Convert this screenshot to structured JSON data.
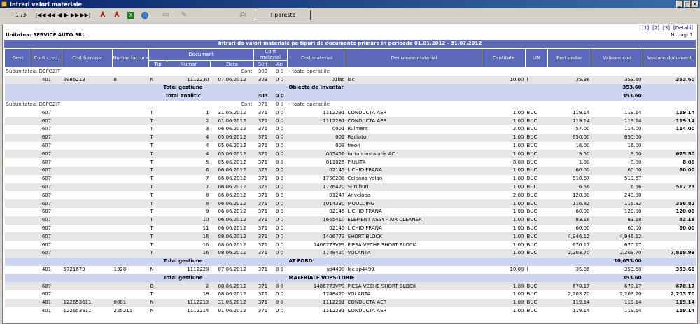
{
  "window": {
    "title": "Intrari valori materiale"
  },
  "toolbar": {
    "page": "1 /3",
    "print_label": "Tipareste",
    "nav": [
      "|◀◀",
      "◀◀",
      "◀",
      "▶",
      "▶▶",
      "▶▶|"
    ]
  },
  "report": {
    "links": [
      "[1]",
      "[2]",
      "[3]",
      "[Detalii]"
    ],
    "unit": "Unitatea: SERVICE AUTO SRL",
    "page_no": "Nr.pag: 1",
    "title": "Intrari de valori materiale pe tipuri de documente primare in perioada 01.01.2012 - 31.07.2012",
    "headers": {
      "gest": "Gest",
      "cont_cred": "Cont cred.",
      "cod_furnizor": "Cod furnizor",
      "numar_factura": "Numar factura",
      "document": "Document",
      "tip": "Tip",
      "numar": "Numar",
      "data": "Data",
      "cont_material": "Cont material",
      "sint": "Sint",
      "an": "An",
      "cod_material": "Cod material",
      "denumire": "Denumire material",
      "cantitate": "Cantitate",
      "um": "UM",
      "pret": "Pret unitar",
      "valoare_cod": "Valoare cod",
      "valoare_doc": "Valoare document"
    },
    "rows": [
      {
        "t": "sub",
        "a": "Subunitatea: DEPOZIT",
        "b": "Cont",
        "c": "303",
        "d": "0 0",
        "e": "- toate operatiile"
      },
      {
        "t": "d",
        "v": [
          "",
          "401",
          "6986213",
          "8",
          "N",
          "1112230",
          "07.06.2012",
          "303",
          "0 0",
          "01lac",
          "lac",
          "10.00",
          "l",
          "35.36",
          "353.60",
          "353.60"
        ]
      },
      {
        "t": "total",
        "a": "Total gestiune",
        "b": "Obiecte de Inventar",
        "v1": "353.60",
        "v2": ""
      },
      {
        "t": "total",
        "a": "Total analitic",
        "c": "303",
        "d": "0 0",
        "v1": "353.60",
        "v2": ""
      },
      {
        "t": "sub",
        "a": "Subunitatea: DEPOZIT",
        "b": "Cont",
        "c": "371",
        "d": "0 0",
        "e": "- toate operatiile"
      },
      {
        "t": "d",
        "v": [
          "",
          "607",
          "",
          "",
          "T",
          "1",
          "31.05.2012",
          "371",
          "0 0",
          "1112291",
          "CONDUCTA AER",
          "1.00",
          "BUC",
          "119.14",
          "119.14",
          "119.14"
        ]
      },
      {
        "t": "d",
        "v": [
          "",
          "607",
          "",
          "",
          "T",
          "2",
          "01.06.2012",
          "371",
          "0 0",
          "1112291",
          "CONDUCTA AER",
          "1.00",
          "BUC",
          "119.14",
          "119.14",
          "119.14"
        ]
      },
      {
        "t": "d",
        "v": [
          "",
          "607",
          "",
          "",
          "T",
          "3",
          "06.06.2012",
          "371",
          "0 0",
          "0001",
          "Rulment",
          "2.00",
          "BUC",
          "57.00",
          "114.00",
          "114.00"
        ]
      },
      {
        "t": "d",
        "v": [
          "",
          "607",
          "",
          "",
          "T",
          "4",
          "05.06.2012",
          "371",
          "0 0",
          "002",
          "Radiator",
          "1.00",
          "BUC",
          "650.00",
          "650.00",
          ""
        ]
      },
      {
        "t": "d",
        "v": [
          "",
          "607",
          "",
          "",
          "T",
          "4",
          "05.06.2012",
          "371",
          "0 0",
          "003",
          "freon",
          "1.00",
          "BUC",
          "16.00",
          "16.00",
          ""
        ]
      },
      {
        "t": "d",
        "v": [
          "",
          "607",
          "",
          "",
          "T",
          "4",
          "05.06.2012",
          "371",
          "0 0",
          "005456",
          "furtun instalatie AC",
          "1.00",
          "BUC",
          "9.50",
          "9.50",
          "675.50"
        ]
      },
      {
        "t": "d",
        "v": [
          "",
          "607",
          "",
          "",
          "T",
          "5",
          "05.06.2012",
          "371",
          "0 0",
          "011025",
          "PIULITA",
          "8.00",
          "BUC",
          "1.00",
          "8.00",
          "8.00"
        ]
      },
      {
        "t": "d",
        "v": [
          "",
          "607",
          "",
          "",
          "T",
          "6",
          "06.06.2012",
          "371",
          "0 0",
          "02145",
          "LICHID FRANA",
          "1.00",
          "BUC",
          "60.00",
          "60.00",
          "60.00"
        ]
      },
      {
        "t": "d",
        "v": [
          "",
          "607",
          "",
          "",
          "T",
          "7",
          "06.06.2012",
          "371",
          "0 0",
          "1758288",
          "Coloana volan",
          "1.00",
          "BUC",
          "510.67",
          "510.67",
          ""
        ]
      },
      {
        "t": "d",
        "v": [
          "",
          "607",
          "",
          "",
          "T",
          "7",
          "06.06.2012",
          "371",
          "0 0",
          "1726420",
          "Suruburi",
          "1.00",
          "BUC",
          "6.56",
          "6.56",
          "517.23"
        ]
      },
      {
        "t": "d",
        "v": [
          "",
          "607",
          "",
          "",
          "T",
          "8",
          "06.06.2012",
          "371",
          "0 0",
          "01247",
          "Anvelopa",
          "2.00",
          "BUC",
          "120.00",
          "240.00",
          ""
        ]
      },
      {
        "t": "d",
        "v": [
          "",
          "607",
          "",
          "",
          "T",
          "8",
          "06.06.2012",
          "371",
          "0 0",
          "1014330",
          "MOULDING",
          "1.00",
          "BUC",
          "116.82",
          "116.82",
          "356.82"
        ]
      },
      {
        "t": "d",
        "v": [
          "",
          "607",
          "",
          "",
          "T",
          "9",
          "06.06.2012",
          "371",
          "0 0",
          "02145",
          "LICHID FRANA",
          "1.00",
          "BUC",
          "60.00",
          "120.00",
          "120.00"
        ]
      },
      {
        "t": "d",
        "v": [
          "",
          "607",
          "",
          "",
          "T",
          "10",
          "06.06.2012",
          "371",
          "0 0",
          "1665410",
          "ELEMENT ASSY - AIR CLEANER",
          "1.00",
          "BUC",
          "83.18",
          "83.18",
          "83.18"
        ]
      },
      {
        "t": "d",
        "v": [
          "",
          "607",
          "",
          "",
          "T",
          "11",
          "06.06.2012",
          "371",
          "0 0",
          "02145",
          "LICHID FRANA",
          "1.00",
          "BUC",
          "60.00",
          "60.00",
          "60.00"
        ]
      },
      {
        "t": "d",
        "v": [
          "",
          "607",
          "",
          "",
          "T",
          "16",
          "08.06.2012",
          "371",
          "0 0",
          "1406773",
          "SHORT BLOCK",
          "1.00",
          "BUC",
          "4,946.12",
          "4,946.12",
          ""
        ]
      },
      {
        "t": "d",
        "v": [
          "",
          "607",
          "",
          "",
          "T",
          "16",
          "08.06.2012",
          "371",
          "0 0",
          "1406773VPS",
          "PIESA VECHE SHORT BLOCK",
          "1.00",
          "BUC",
          "670.17",
          "670.17",
          ""
        ]
      },
      {
        "t": "d",
        "v": [
          "",
          "607",
          "",
          "",
          "T",
          "16",
          "08.06.2012",
          "371",
          "0 0",
          "1748420",
          "VOLANTA",
          "1.00",
          "BUC",
          "2,203.70",
          "2,203.70",
          "7,819.99"
        ]
      },
      {
        "t": "total",
        "a": "Total gestiune",
        "b": "AT FORD",
        "v1": "10,053.00",
        "v2": ""
      },
      {
        "t": "d",
        "v": [
          "",
          "401",
          "5721679",
          "1328",
          "N",
          "1112229",
          "07.06.2012",
          "371",
          "0 0",
          "sp4499",
          "lac sp4499",
          "10.00",
          "l",
          "35.36",
          "353.60",
          "353.60"
        ]
      },
      {
        "t": "total",
        "a": "Total gestiune",
        "b": "MATERIALE VOPSITORIE",
        "v1": "353.60",
        "v2": ""
      },
      {
        "t": "d",
        "v": [
          "",
          "607",
          "",
          "",
          "B",
          "2",
          "08.06.2012",
          "371",
          "0 0",
          "1406773VPS",
          "PIESA VECHE SHORT BLOCK",
          "1.00",
          "BUC",
          "670.17",
          "670.17",
          "670.17"
        ]
      },
      {
        "t": "d",
        "v": [
          "",
          "607",
          "",
          "",
          "T",
          "18",
          "08.06.2012",
          "371",
          "0 0",
          "1748420",
          "VOLANTA",
          "1.00",
          "BUC",
          "2,203.70",
          "2,203.70",
          "2,203.70"
        ]
      },
      {
        "t": "d",
        "v": [
          "",
          "401",
          "122653611",
          "0001",
          "N",
          "1112213",
          "31.05.2012",
          "371",
          "0 0",
          "1112291",
          "CONDUCTA AER",
          "1.00",
          "BUC",
          "119.14",
          "119.14",
          "119.14"
        ]
      },
      {
        "t": "d",
        "v": [
          "",
          "401",
          "122653611",
          "225211",
          "N",
          "1112214",
          "01.06.2012",
          "371",
          "0 0",
          "1112291",
          "CONDUCTA AER",
          "1.00",
          "BUC",
          "119.14",
          "119.14",
          "119.14"
        ]
      }
    ]
  }
}
